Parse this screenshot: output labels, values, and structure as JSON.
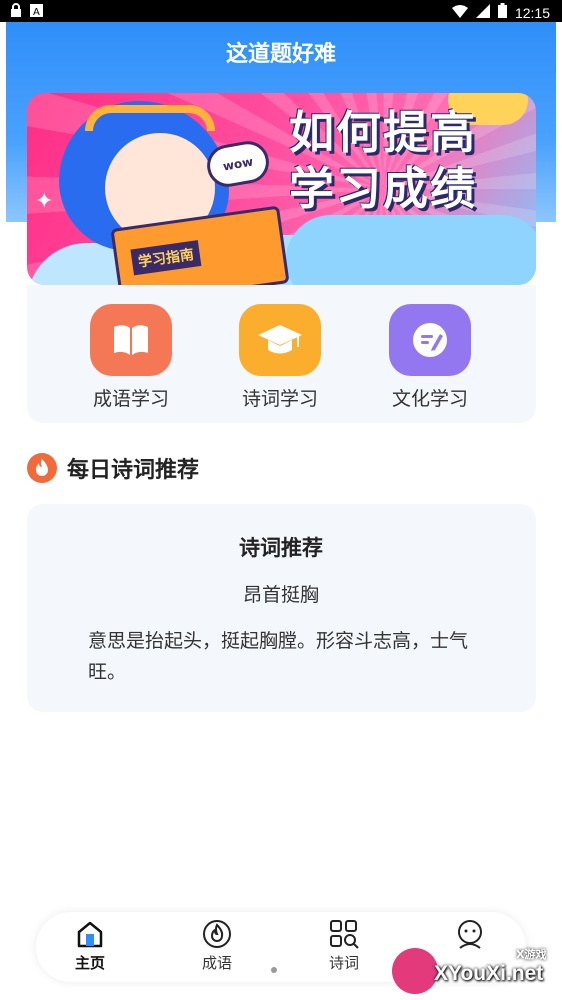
{
  "status_bar": {
    "time": "12:15",
    "left_icons": [
      "lock-icon",
      "app-a-icon"
    ],
    "right_icons": [
      "wifi-icon",
      "signal-icon",
      "battery-icon"
    ]
  },
  "header": {
    "title": "这道题好难"
  },
  "banner": {
    "headline_line1": "如何提高",
    "headline_line2": "学习成绩",
    "book_label": "学习指南",
    "bubble_text": "wow"
  },
  "categories": [
    {
      "label": "成语学习",
      "icon": "open-book-icon",
      "color": "#f57856"
    },
    {
      "label": "诗词学习",
      "icon": "graduation-cap-icon",
      "color": "#fbae2e"
    },
    {
      "label": "文化学习",
      "icon": "pencil-chat-icon",
      "color": "#9377f0"
    }
  ],
  "daily_section": {
    "title": "每日诗词推荐",
    "icon": "fire-icon"
  },
  "poem_card": {
    "title": "诗词推荐",
    "word": "昂首挺胸",
    "description": "意思是抬起头，挺起胸膛。形容斗志高，士气旺。"
  },
  "bottom_nav": [
    {
      "label": "主页",
      "icon": "home-icon",
      "active": true
    },
    {
      "label": "成语",
      "icon": "flame-circle-icon",
      "active": false
    },
    {
      "label": "诗词",
      "icon": "grid-search-icon",
      "active": false
    },
    {
      "label": "",
      "icon": "smiley-profile-icon",
      "active": false
    }
  ],
  "watermark": {
    "text": "XYouXi.net",
    "small": "X游戏"
  },
  "colors": {
    "header_blue": "#2f8ef8",
    "card_bg": "#f4f7fc",
    "accent_fire": "#f06a3c"
  }
}
